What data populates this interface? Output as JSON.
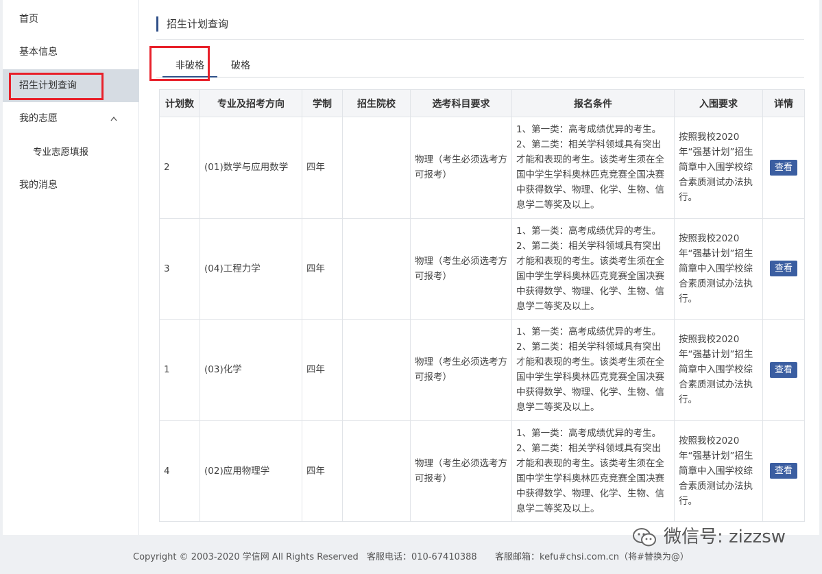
{
  "sidebar": {
    "items": [
      {
        "label": "首页"
      },
      {
        "label": "基本信息"
      },
      {
        "label": "招生计划查询"
      },
      {
        "label": "我的志愿",
        "chevron": "^"
      },
      {
        "label": "专业志愿填报"
      },
      {
        "label": "我的消息"
      }
    ]
  },
  "main": {
    "title": "招生计划查询",
    "tabs": [
      {
        "label": "非破格"
      },
      {
        "label": "破格"
      }
    ]
  },
  "table": {
    "headers": [
      "计划数",
      "专业及招考方向",
      "学制",
      "招生院校",
      "选考科目要求",
      "报名条件",
      "入围要求",
      "详情"
    ],
    "rows": [
      {
        "count": "2",
        "major": "(01)数学与应用数学",
        "years": "四年",
        "school": "",
        "subjects": "物理（考生必须选考方可报考）",
        "conditions": "1、第一类：高考成绩优异的考生。2、第二类：相关学科领域具有突出才能和表现的考生。该类考生须在全国中学生学科奥林匹克竞赛全国决赛中获得数学、物理、化学、生物、信息学二等奖及以上。",
        "requirement": "按照我校2020年“强基计划”招生简章中入围学校综合素质测试办法执行。",
        "action": "查看"
      },
      {
        "count": "3",
        "major": "(04)工程力学",
        "years": "四年",
        "school": "",
        "subjects": "物理（考生必须选考方可报考）",
        "conditions": "1、第一类：高考成绩优异的考生。2、第二类：相关学科领域具有突出才能和表现的考生。该类考生须在全国中学生学科奥林匹克竞赛全国决赛中获得数学、物理、化学、生物、信息学二等奖及以上。",
        "requirement": "按照我校2020年“强基计划”招生简章中入围学校综合素质测试办法执行。",
        "action": "查看"
      },
      {
        "count": "1",
        "major": "(03)化学",
        "years": "四年",
        "school": "",
        "subjects": "物理（考生必须选考方可报考）",
        "conditions": "1、第一类：高考成绩优异的考生。2、第二类：相关学科领域具有突出才能和表现的考生。该类考生须在全国中学生学科奥林匹克竞赛全国决赛中获得数学、物理、化学、生物、信息学二等奖及以上。",
        "requirement": "按照我校2020年“强基计划”招生简章中入围学校综合素质测试办法执行。",
        "action": "查看"
      },
      {
        "count": "4",
        "major": "(02)应用物理学",
        "years": "四年",
        "school": "",
        "subjects": "物理（考生必须选考方可报考）",
        "conditions": "1、第一类：高考成绩优异的考生。2、第二类：相关学科领域具有突出才能和表现的考生。该类考生须在全国中学生学科奥林匹克竞赛全国决赛中获得数学、物理、化学、生物、信息学二等奖及以上。",
        "requirement": "按照我校2020年“强基计划”招生简章中入围学校综合素质测试办法执行。",
        "action": "查看"
      }
    ]
  },
  "footer": {
    "copyright": "Copyright © 2003-2020 学信网 All Rights Reserved",
    "phone": "客服电话：010-67410388",
    "email": "客服邮箱：kefu#chsi.com.cn（将#替换为@）"
  },
  "watermark": {
    "text": "微信号: zizzsw",
    "icon": "wechat-icon"
  },
  "colors": {
    "accent": "#2f4f88",
    "button": "#3b5ea1",
    "highlight_border": "#e8202a",
    "active_nav": "#d6dce3"
  }
}
